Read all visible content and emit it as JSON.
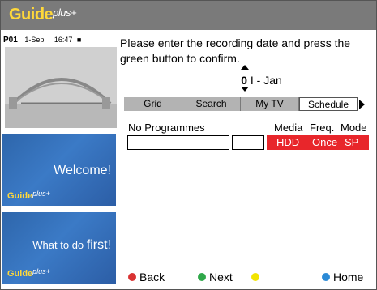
{
  "header": {
    "logo_main": "Guide",
    "logo_plus": "plus+"
  },
  "channel": {
    "id": "P01",
    "date": "1-Sep",
    "time": "16:47"
  },
  "instruction": "Please enter the recording date and press the green button to confirm.",
  "date_input": {
    "day": "0",
    "separator": "I - Jan"
  },
  "tabs": [
    {
      "label": "Grid"
    },
    {
      "label": "Search"
    },
    {
      "label": "My TV"
    },
    {
      "label": "Schedule"
    }
  ],
  "columns": {
    "programmes": "No Programmes",
    "media": "Media",
    "freq": "Freq.",
    "mode": "Mode"
  },
  "recording": {
    "media": "HDD",
    "freq": "Once",
    "mode": "SP"
  },
  "panels": {
    "welcome": "Welcome!",
    "what_prefix": "What to do",
    "what_first": "first!",
    "mini_logo": "Guide",
    "mini_plus": "plus+"
  },
  "footer": {
    "back": "Back",
    "next": "Next",
    "home": "Home"
  },
  "colors": {
    "red": "#d93232",
    "green": "#2fa84a",
    "yellow": "#f2e400",
    "blue": "#2b8ad6",
    "record_red": "#e8262b"
  }
}
